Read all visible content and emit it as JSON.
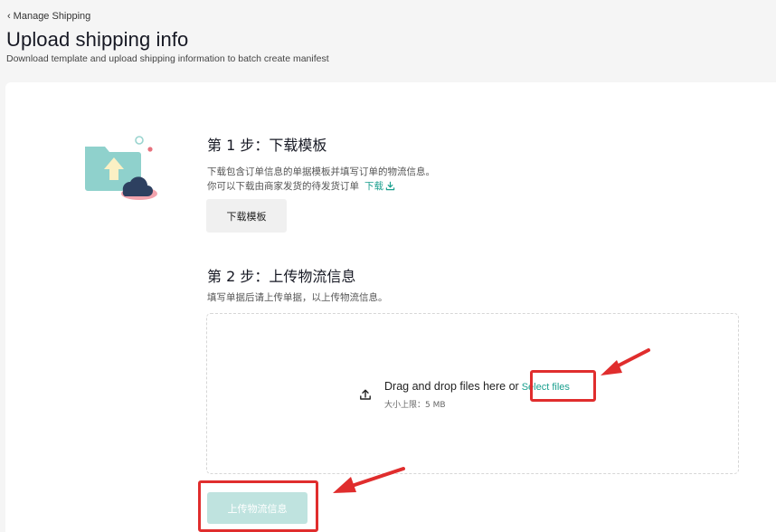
{
  "header": {
    "back_label": "Manage Shipping",
    "title": "Upload shipping info",
    "subtitle": "Download template and upload shipping information to batch create manifest"
  },
  "step1": {
    "title": "第 1 步：下载模板",
    "desc_line1": "下载包含订单信息的单据模板并填写订单的物流信息。",
    "desc_line2": "你可以下载由商家发货的待发货订单",
    "download_link": "下载",
    "template_button": "下载模板"
  },
  "step2": {
    "title": "第 2 步：上传物流信息",
    "desc": "填写单据后请上传单据，以上传物流信息。",
    "dropzone_text": "Drag and drop files here or",
    "select_files": "Select files",
    "size_limit": "大小上限：5 MB",
    "upload_button": "上传物流信息"
  },
  "colors": {
    "accent": "#1a9f8e",
    "upload_button_disabled": "#bfe3df",
    "highlight": "#e02d2d"
  }
}
